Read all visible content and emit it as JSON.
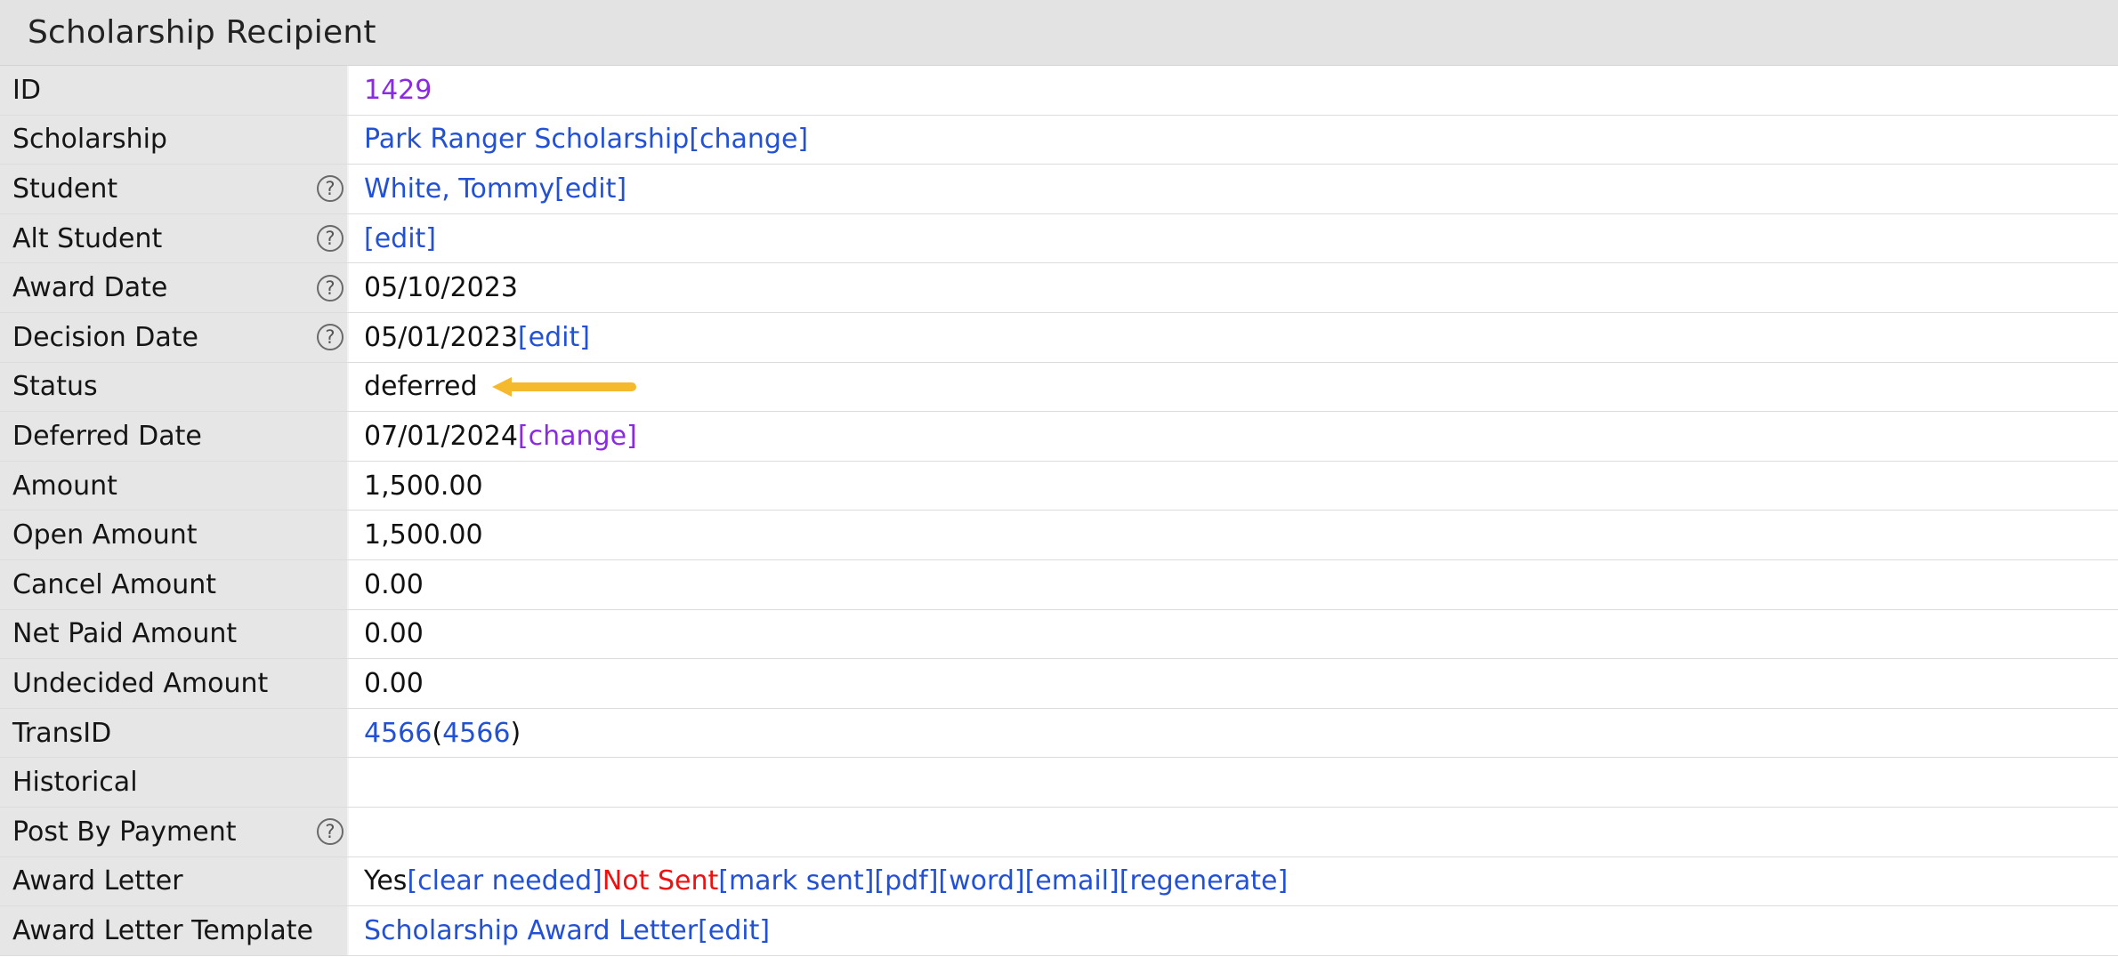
{
  "panel": {
    "title": "Scholarship Recipient"
  },
  "help_glyph": "?",
  "rows": {
    "id": {
      "label": "ID",
      "value": "1429"
    },
    "scholarship": {
      "label": "Scholarship",
      "name": "Park Ranger Scholarship",
      "action": "[change]"
    },
    "student": {
      "label": "Student",
      "name": "White, Tommy",
      "action": "[edit]"
    },
    "alt_student": {
      "label": "Alt Student",
      "action": "[edit]"
    },
    "award_date": {
      "label": "Award Date",
      "value": "05/10/2023"
    },
    "decision_date": {
      "label": "Decision Date",
      "value": "05/01/2023",
      "action": "[edit]"
    },
    "status": {
      "label": "Status",
      "value": "deferred"
    },
    "deferred_date": {
      "label": "Deferred Date",
      "value": "07/01/2024",
      "action": "[change]"
    },
    "amount": {
      "label": "Amount",
      "value": "1,500.00"
    },
    "open_amount": {
      "label": "Open Amount",
      "value": "1,500.00"
    },
    "cancel_amount": {
      "label": "Cancel Amount",
      "value": "0.00"
    },
    "net_paid_amount": {
      "label": "Net Paid Amount",
      "value": "0.00"
    },
    "undecided_amount": {
      "label": "Undecided Amount",
      "value": "0.00"
    },
    "trans_id": {
      "label": "TransID",
      "id": "4566",
      "paren_open": "(",
      "linked_id": "4566",
      "paren_close": ")"
    },
    "historical": {
      "label": "Historical",
      "value": ""
    },
    "post_by_payment": {
      "label": "Post By Payment",
      "value": ""
    },
    "award_letter": {
      "label": "Award Letter",
      "value": "Yes",
      "clear_needed": "[clear needed]",
      "status": "Not Sent",
      "mark_sent": "[mark sent]",
      "pdf": "[pdf]",
      "word": "[word]",
      "email": "[email]",
      "regenerate": "[regenerate]"
    },
    "award_letter_template": {
      "label": "Award Letter Template",
      "name": "Scholarship Award Letter",
      "action": "[edit]"
    }
  },
  "colors": {
    "link": "#2351d6",
    "visited_link": "#8a2be2",
    "not_sent": "#ee1111",
    "annotation_arrow": "#f5b92e",
    "label_bg": "#e6e6e6",
    "header_bg": "#e3e3e3"
  }
}
